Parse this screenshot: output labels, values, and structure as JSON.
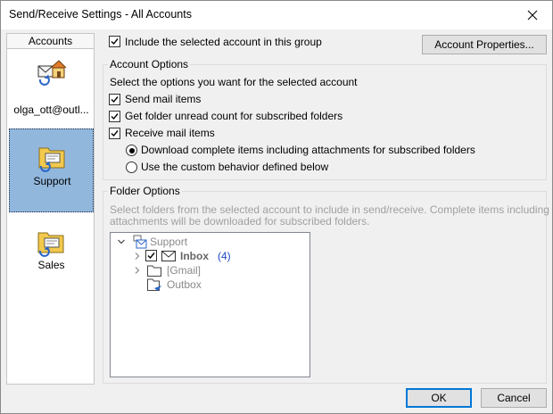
{
  "window": {
    "title": "Send/Receive Settings - All Accounts"
  },
  "accounts": {
    "header": "Accounts",
    "items": [
      {
        "label": "olga_ott@outl...",
        "icon": "house-mail-icon",
        "selected": false
      },
      {
        "label": "Support",
        "icon": "folder-sync-icon",
        "selected": true
      },
      {
        "label": "Sales",
        "icon": "folder-sync-icon",
        "selected": false
      }
    ]
  },
  "include_group": {
    "label": "Include the selected account in this group",
    "checked": true
  },
  "account_properties_label": "Account Properties...",
  "account_options": {
    "legend": "Account Options",
    "description": "Select the options you want for the selected account",
    "send_mail": {
      "label": "Send mail items",
      "checked": true
    },
    "unread_count": {
      "label": "Get folder unread count for subscribed folders",
      "checked": true
    },
    "receive_mail": {
      "label": "Receive mail items",
      "checked": true
    },
    "radio_complete": {
      "label": "Download complete items including attachments for subscribed folders",
      "selected": true
    },
    "radio_custom": {
      "label": "Use the custom behavior defined below",
      "selected": false
    }
  },
  "folder_options": {
    "legend": "Folder Options",
    "description_line1": "Select folders from the selected account to include in send/receive. Complete items including",
    "description_line2": "attachments will be downloaded for subscribed folders.",
    "tree": {
      "root": "Support",
      "inbox": {
        "label": "Inbox",
        "count": "(4)",
        "checked": true
      },
      "gmail": "[Gmail]",
      "outbox": "Outbox"
    }
  },
  "buttons": {
    "ok": "OK",
    "cancel": "Cancel"
  },
  "colors": {
    "selected_account_bg": "#91b7dd",
    "default_button_border": "#0078d7",
    "count_blue": "#1f45c6"
  }
}
